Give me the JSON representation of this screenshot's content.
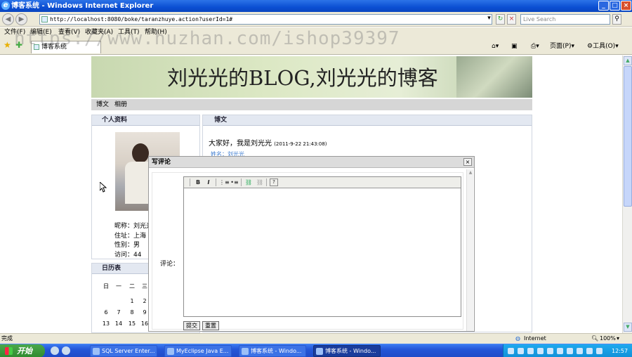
{
  "window": {
    "title": "博客系统 - Windows Internet Explorer",
    "minimize": "_",
    "maximize": "□",
    "close": "×"
  },
  "address": {
    "back": "◀",
    "forward": "▶",
    "url": "http://localhost:8080/boke/taranzhuye.action?userId=1#",
    "refresh": "↻",
    "stop": "×",
    "search_placeholder": "Live Search",
    "search_go": "⚲"
  },
  "menu": {
    "file": "文件(F)",
    "edit": "编辑(E)",
    "view": "查看(V)",
    "favorites": "收藏夹(A)",
    "tools": "工具(T)",
    "help": "帮助(H)"
  },
  "tabs": {
    "active_tab": "博客系统"
  },
  "toolbar": {
    "page": "页面(P)",
    "tools": "工具(O)"
  },
  "watermark": "https://www.huzhan.com/ishop39397",
  "blog": {
    "banner_title": "刘光光的BLOG,刘光光的博客",
    "nav": [
      "博文",
      "相册"
    ],
    "profile_header": "个人资料",
    "profile": {
      "nickname": "昵称：刘光光",
      "address": "住址：上海",
      "gender": "性别：男",
      "visits": "访问：44"
    },
    "posts_header": "博文",
    "post": {
      "title": "大家好，我是刘光光",
      "time": "(2011-9-22 21:43:08)",
      "author": "姓名：刘光光"
    },
    "calendar_header": "日历表",
    "calendar_weekdays": [
      "日",
      "一",
      "二",
      "三"
    ],
    "calendar_rows": [
      [
        "",
        "",
        "1",
        "2"
      ],
      [
        "6",
        "7",
        "8",
        "9"
      ],
      [
        "13",
        "14",
        "15",
        "16"
      ]
    ]
  },
  "dialog": {
    "title": "写评论",
    "close": "×",
    "label": "评论：",
    "tools": {
      "bold": "B",
      "italic": "I",
      "ordered_list": "⋮≡",
      "bullet_list": "•≡",
      "link": "⛓",
      "unlink": "⛓",
      "help": "?"
    },
    "submit": "提交",
    "reset": "重置"
  },
  "status": {
    "done": "完成",
    "zone": "Internet",
    "zoom": "100%"
  },
  "taskbar": {
    "start": "开始",
    "tasks": [
      "SQL Server Enter...",
      "MyEclipse Java E...",
      "博客系统 - Windo...",
      "博客系统 - Windo..."
    ],
    "clock": "12:57"
  }
}
